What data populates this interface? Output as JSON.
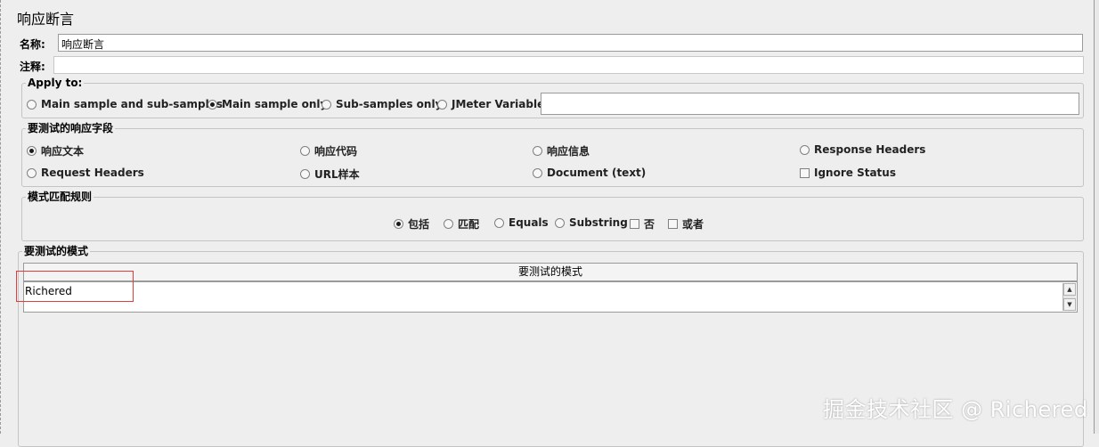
{
  "title": "响应断言",
  "name": {
    "label": "名称:",
    "value": "响应断言"
  },
  "comment": {
    "label": "注释:",
    "value": ""
  },
  "apply_to": {
    "legend": "Apply to:",
    "options": [
      "Main sample and sub-samples",
      "Main sample only",
      "Sub-samples only",
      "JMeter Variable"
    ],
    "selected": "Main sample only",
    "variable_value": ""
  },
  "field_to_test": {
    "legend": "要测试的响应字段",
    "options": [
      "响应文本",
      "响应代码",
      "响应信息",
      "Response Headers",
      "Request Headers",
      "URL样本",
      "Document (text)"
    ],
    "selected": "响应文本",
    "ignore_status": "Ignore Status"
  },
  "pattern_rules": {
    "legend": "模式匹配规则",
    "options": [
      "包括",
      "匹配",
      "Equals",
      "Substring"
    ],
    "selected": "包括",
    "not": "否",
    "or": "或者"
  },
  "patterns": {
    "legend": "要测试的模式",
    "column": "要测试的模式",
    "rows": [
      "Richered"
    ]
  },
  "watermark": "掘金技术社区 @ Richered",
  "colors": {
    "background": "#eeeeee",
    "highlight": "#e23b3b"
  }
}
